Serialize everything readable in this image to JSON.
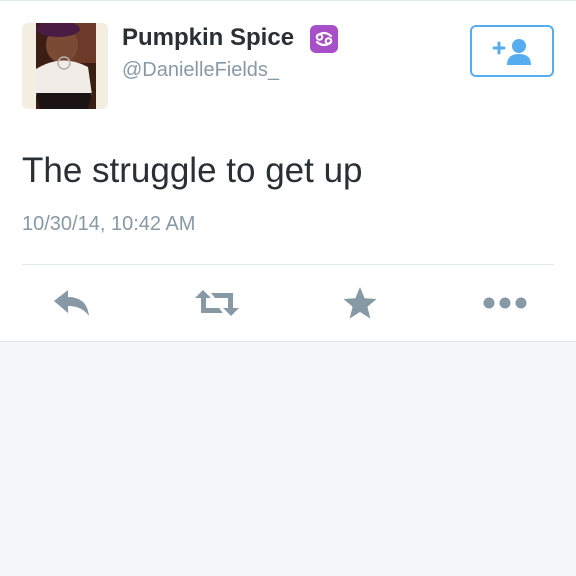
{
  "tweet": {
    "display_name": "Pumpkin Spice",
    "zodiac_icon": "cancer-zodiac-icon",
    "username": "@DanielleFields_",
    "text": "The struggle to get up",
    "timestamp": "10/30/14, 10:42 AM"
  },
  "actions": {
    "follow": "follow-user-icon",
    "reply": "reply-icon",
    "retweet": "retweet-icon",
    "favorite": "star-icon",
    "more": "more-dots-icon"
  },
  "colors": {
    "accent": "#55acee",
    "icon_gray": "#8899a6",
    "text_dark": "#292f33",
    "zodiac_purple": "#a64fc8",
    "background": "#f5f8fa"
  }
}
